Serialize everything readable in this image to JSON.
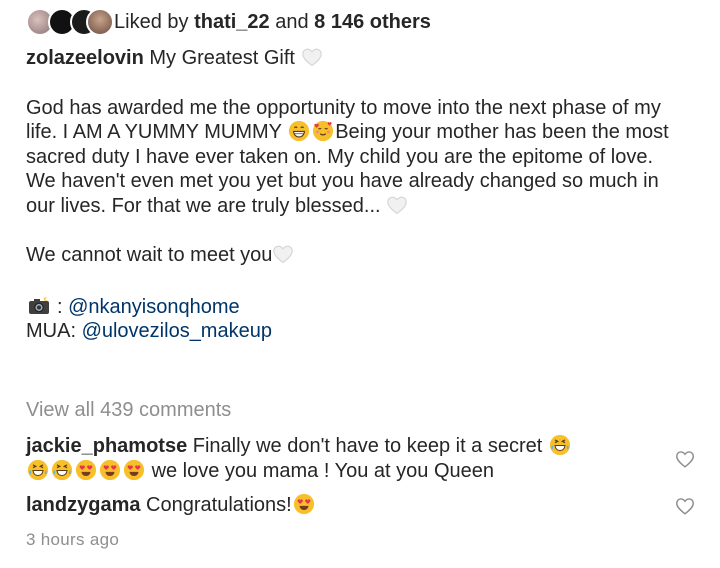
{
  "likes": {
    "prefix": "Liked by",
    "user": "thati_22",
    "connector": "and",
    "others": "8 146 others"
  },
  "caption": {
    "username": "zolazeelovin",
    "title": "My Greatest Gift",
    "para1_a": "God has awarded me the opportunity to move into the next phase of my life. I AM A YUMMY MUMMY",
    "para1_b": "Being your mother has been the most sacred duty I have ever taken on. My child you are the epitome of love. We haven't even met you yet but you have already changed so much in our lives. For that we are truly blessed...",
    "para2": "We cannot wait to meet you",
    "photo_mention": "@nkanyisonqhome",
    "mua_label": "MUA:",
    "mua_mention": "@ulovezilos_makeup"
  },
  "view_all": "View all 439 comments",
  "comments": [
    {
      "username": "jackie_phamotse",
      "text_a": "Finally we don't have to keep it a secret",
      "text_b": "we love you mama ! You at you Queen"
    },
    {
      "username": "landzygama",
      "text_a": "Congratulations!"
    }
  ],
  "timestamp": "3 hours ago",
  "icons": {
    "heart": "white-heart-emoji",
    "like": "heart-outline-icon",
    "camera": "camera-flash-icon"
  },
  "colors": {
    "text": "#262626",
    "muted": "#8e8e8e",
    "mention": "#003569",
    "emoji_yellow": "#f7c02b"
  }
}
